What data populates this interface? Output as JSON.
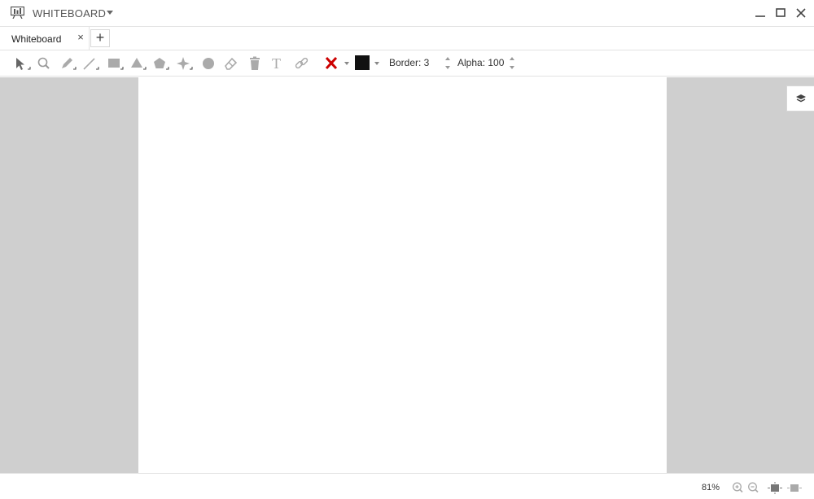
{
  "app": {
    "title": "WHITEBOARD"
  },
  "window_controls": {
    "minimize_icon": "minimize-icon",
    "maximize_icon": "maximize-icon",
    "close_icon": "close-icon"
  },
  "tabs": [
    {
      "label": "Whiteboard",
      "active": true,
      "close_glyph": "×"
    }
  ],
  "tab_add_glyph": "+",
  "toolbar": {
    "tools": [
      {
        "name": "select",
        "icon": "cursor-icon",
        "has_submenu": true
      },
      {
        "name": "zoom",
        "icon": "magnifier-icon",
        "has_submenu": false
      },
      {
        "name": "pen",
        "icon": "pen-icon",
        "has_submenu": true
      },
      {
        "name": "line",
        "icon": "line-icon",
        "has_submenu": true
      },
      {
        "name": "rectangle",
        "icon": "rectangle-icon",
        "has_submenu": true
      },
      {
        "name": "triangle",
        "icon": "triangle-icon",
        "has_submenu": true
      },
      {
        "name": "pentagon",
        "icon": "pentagon-icon",
        "has_submenu": true
      },
      {
        "name": "star",
        "icon": "star-icon",
        "has_submenu": true
      },
      {
        "name": "circle",
        "icon": "circle-icon",
        "has_submenu": false
      },
      {
        "name": "eraser",
        "icon": "eraser-icon",
        "has_submenu": false
      },
      {
        "name": "delete",
        "icon": "trash-icon",
        "has_submenu": false
      },
      {
        "name": "text",
        "icon": "text-icon",
        "glyph": "T",
        "has_submenu": false
      },
      {
        "name": "link",
        "icon": "link-icon",
        "has_submenu": false
      }
    ],
    "fill_color": "#cc0000",
    "fill_icon": "no-fill-x-icon",
    "stroke_color": "#111111",
    "border_label": "Border: 3",
    "alpha_label": "Alpha: 100"
  },
  "workspace": {
    "background": "#cfcfcf",
    "page_color": "#ffffff",
    "layers_icon": "layers-icon"
  },
  "statusbar": {
    "zoom_level": "81%",
    "zoom_in_icon": "zoom-in-icon",
    "zoom_out_icon": "zoom-out-icon",
    "fit_page_icon": "fit-page-icon",
    "fit_width_icon": "fit-width-icon"
  }
}
